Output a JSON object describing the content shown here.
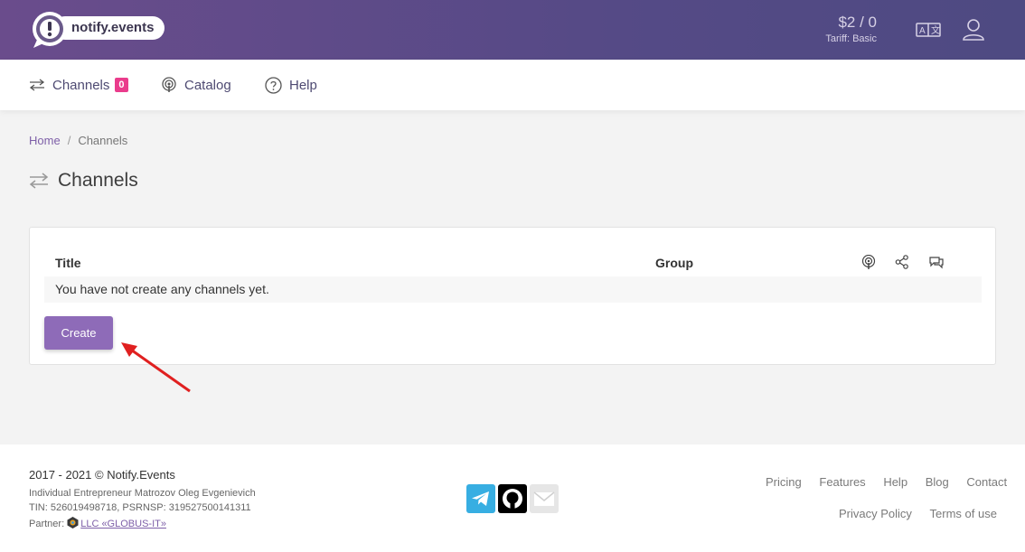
{
  "header": {
    "logo_text": "notify.events",
    "balance": "$2 / 0",
    "tariff": "Tariff: Basic",
    "icons": [
      "translate-icon",
      "user-icon"
    ]
  },
  "nav": {
    "channels_label": "Channels",
    "channels_count": "0",
    "catalog_label": "Catalog",
    "help_label": "Help"
  },
  "breadcrumb": {
    "home": "Home",
    "separator": "/",
    "current": "Channels"
  },
  "page": {
    "title": "Channels"
  },
  "table": {
    "col_title": "Title",
    "col_group": "Group",
    "column_icons": [
      "sources-icon",
      "share-icon",
      "messengers-icon"
    ],
    "empty_message": "You have not create any channels yet.",
    "create_label": "Create"
  },
  "footer": {
    "copyright": "2017 - 2021 © Notify.Events",
    "entrepreneur": "Individual Entrepreneur Matrozov Oleg Evgenievich",
    "tin": "TIN: 526019498718, PSRNSP: 319527500141311",
    "partner_label": "Partner:",
    "partner_link": "LLC «GLOBUS-IT»",
    "social": [
      "telegram-icon",
      "github-icon",
      "email-icon"
    ],
    "links_row1": [
      "Pricing",
      "Features",
      "Help",
      "Blog",
      "Contact"
    ],
    "links_row2": [
      "Privacy Policy",
      "Terms of use"
    ]
  },
  "colors": {
    "header_gradient_start": "#6a4c8c",
    "header_gradient_end": "#4e4a82",
    "accent": "#8e6bb8",
    "badge": "#ea3c8c",
    "arrow": "#e02020"
  }
}
